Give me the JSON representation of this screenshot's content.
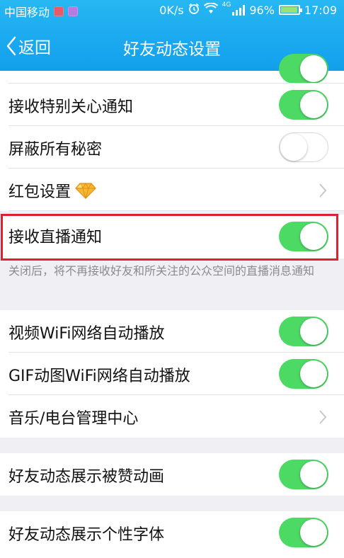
{
  "status_bar": {
    "carrier": "中国移动",
    "speed": "0K/s",
    "network_type": "4G",
    "battery": "96%",
    "time": "17:09",
    "battery_level": 0.96
  },
  "nav": {
    "back_label": "返回",
    "title": "好友动态设置"
  },
  "settings": {
    "special_care": {
      "label": "接收特别关心通知",
      "on": true
    },
    "block_secrets": {
      "label": "屏蔽所有秘密",
      "on": false
    },
    "red_packet": {
      "label": "红包设置"
    },
    "live_notify": {
      "label": "接收直播通知",
      "on": true,
      "description": "关闭后，将不再接收好友和所关注的公众空间的直播消息通知"
    },
    "video_autoplay": {
      "label": "视频WiFi网络自动播放",
      "on": true
    },
    "gif_autoplay": {
      "label": "GIF动图WiFi网络自动播放",
      "on": true
    },
    "music_center": {
      "label": "音乐/电台管理中心"
    },
    "like_animation": {
      "label": "好友动态展示被赞动画",
      "on": true
    },
    "custom_font": {
      "label": "好友动态展示个性字体",
      "on": true
    }
  },
  "colors": {
    "header_blue": "#1aa8ef",
    "toggle_on": "#4cd964",
    "highlight_red": "#e02030"
  }
}
